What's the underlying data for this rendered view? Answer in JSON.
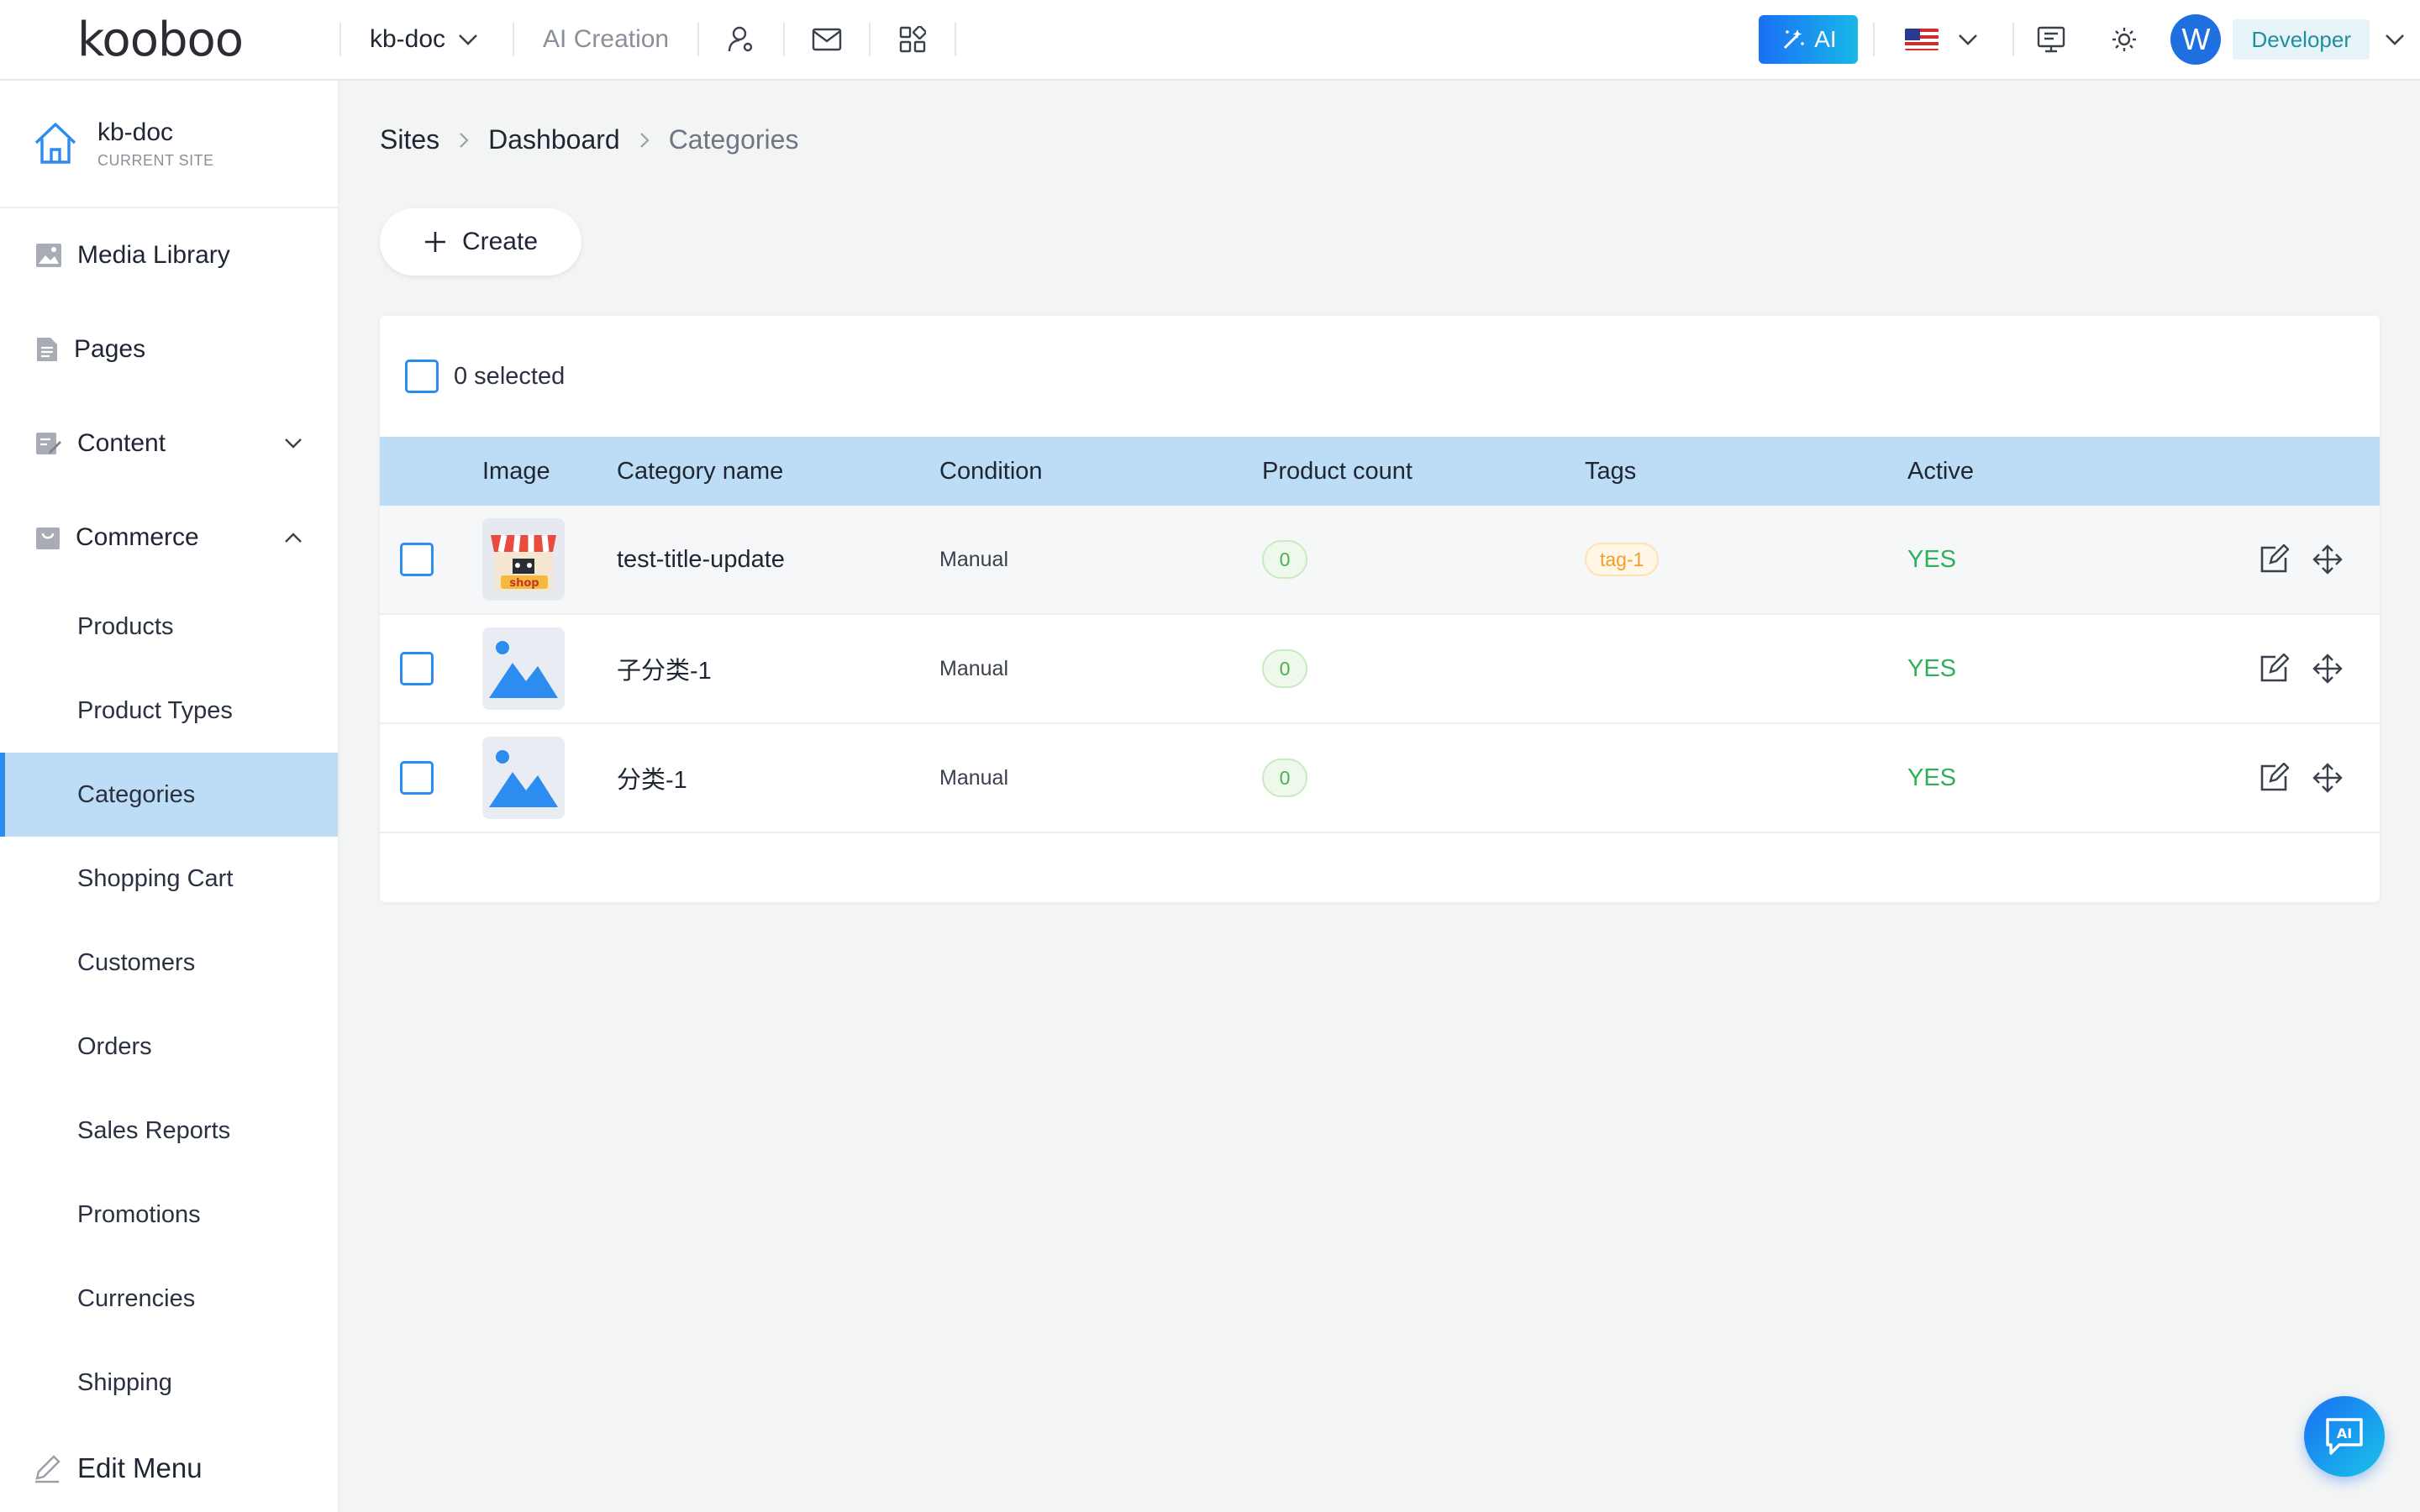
{
  "header": {
    "logo": "kooboo",
    "site_switch": "kb-doc",
    "ai_creation": "AI Creation",
    "icons": [
      "user-settings-icon",
      "mail-icon",
      "apps-grid-icon"
    ],
    "ai_button": "AI",
    "language_flag": "us-flag-icon",
    "avatar_letter": "W",
    "role": "Developer"
  },
  "sidebar": {
    "current_site": {
      "name": "kb-doc",
      "subtitle": "CURRENT SITE"
    },
    "items": [
      {
        "label": "Media Library",
        "icon": "image-icon"
      },
      {
        "label": "Pages",
        "icon": "page-icon"
      },
      {
        "label": "Content",
        "icon": "edit-doc-icon",
        "expanded": false
      },
      {
        "label": "Commerce",
        "icon": "bag-icon",
        "expanded": true
      }
    ],
    "commerce_sub": [
      "Products",
      "Product Types",
      "Categories",
      "Shopping Cart",
      "Customers",
      "Orders",
      "Sales Reports",
      "Promotions",
      "Currencies",
      "Shipping"
    ],
    "active_sub": "Categories",
    "edit_menu": "Edit Menu"
  },
  "breadcrumb": {
    "sites": "Sites",
    "dashboard": "Dashboard",
    "current": "Categories"
  },
  "toolbar": {
    "create_label": "Create"
  },
  "table": {
    "selected_text": "0 selected",
    "columns": {
      "image": "Image",
      "name": "Category name",
      "condition": "Condition",
      "count": "Product count",
      "tags": "Tags",
      "active": "Active"
    },
    "rows": [
      {
        "name": "test-title-update",
        "condition": "Manual",
        "count": "0",
        "tag": "tag-1",
        "active": "YES",
        "thumb": "shop-thumbnail"
      },
      {
        "name": "子分类-1",
        "condition": "Manual",
        "count": "0",
        "tag": "",
        "active": "YES",
        "thumb": "image-placeholder"
      },
      {
        "name": "分类-1",
        "condition": "Manual",
        "count": "0",
        "tag": "",
        "active": "YES",
        "thumb": "image-placeholder"
      }
    ]
  },
  "floating_button": {
    "label": "AI"
  }
}
